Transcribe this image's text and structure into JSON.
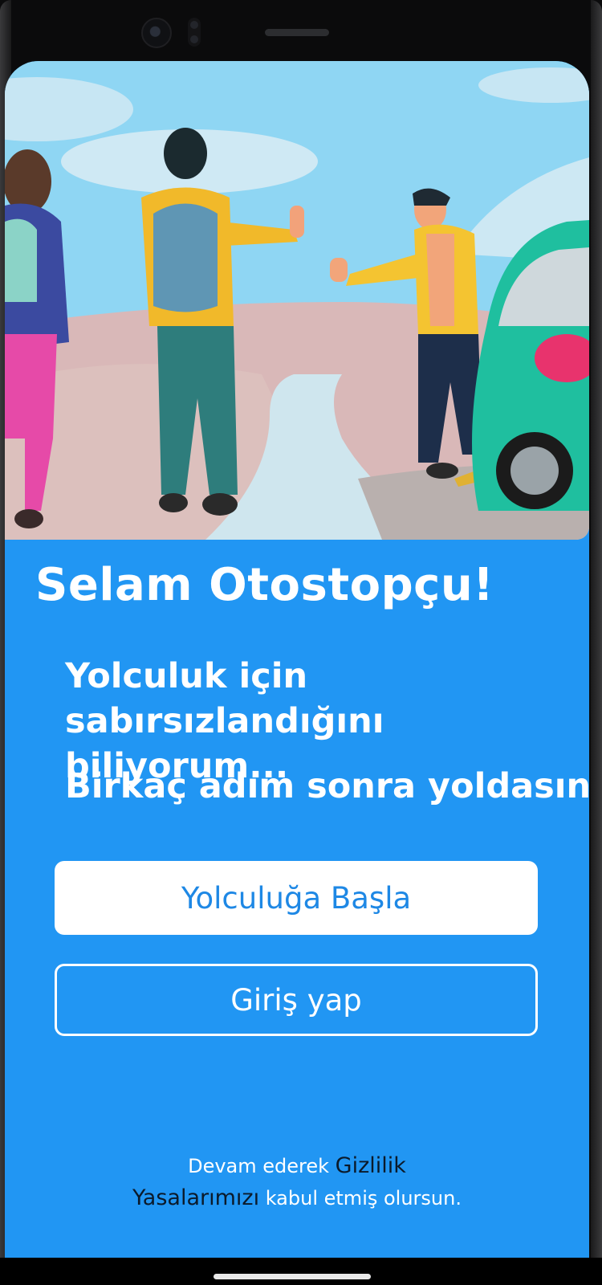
{
  "hero": {
    "illustration": "hitchhikers-thumbs-up-beside-car"
  },
  "welcome": {
    "title": "Selam Otostopçu!",
    "subtitle_line1": "Yolculuk için",
    "subtitle_line2": "sabırsızlandığını biliyorum...",
    "subtitle_secondary": "Birkaç adım sonra yoldasın :)"
  },
  "actions": {
    "start_label": "Yolculuğa Başla",
    "login_label": "Giriş yap"
  },
  "legal": {
    "prefix": "Devam ederek ",
    "link_word1": "Gizlilik",
    "link_word2": "Yasalarımızı",
    "suffix": " kabul etmiş olursun."
  },
  "colors": {
    "primary": "#2196f3",
    "button_text": "#1e88e5",
    "link": "#0b1a2a"
  }
}
